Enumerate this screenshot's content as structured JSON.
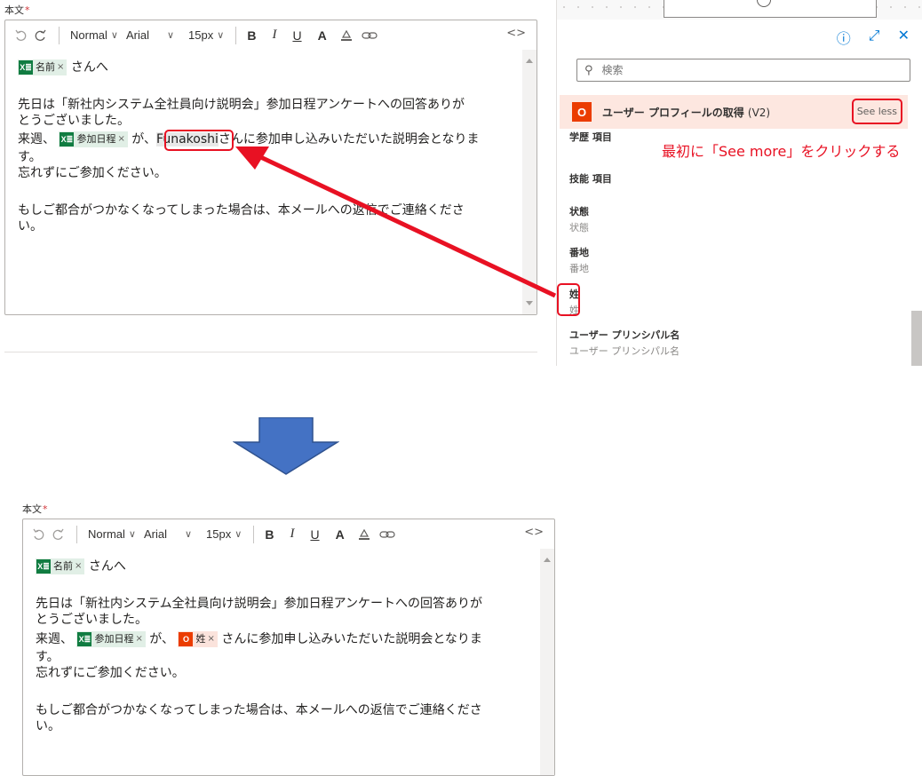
{
  "editor": {
    "field_label": "本文",
    "required_mark": "*",
    "toolbar": {
      "paragraph_style": "Normal",
      "font": "Arial",
      "size": "15px",
      "bold": "B",
      "italic": "I",
      "underline": "U",
      "font_color": "A",
      "code_view": "<>"
    },
    "tokens": {
      "name": "名前",
      "date": "参加日程",
      "surname": "姓",
      "remove": "×"
    },
    "text": {
      "greeting_suffix": "さんへ",
      "line1": "先日は「新社内システム全社員向け説明会」参加日程アンケートへの回答ありが",
      "line2": "とうございました。",
      "line3_pre": "来週、",
      "line3_mid": "が、",
      "literal_name": "Funakoshi",
      "line3_post": "さんに参加申し込みいただいた説明会となりま",
      "line3_post_after": "さんに参加申し込みいただいた説明会となりま",
      "line4": "す。",
      "line5": "忘れずにご参加ください。",
      "line6": "もしご都合がつかなくなってしまった場合は、本メールへの返信でご連絡くださ",
      "line7": "い。"
    }
  },
  "panel": {
    "search_placeholder": "検索",
    "action_title": "ユーザー プロフィールの取得",
    "action_version": "(V2)",
    "see_less": "See less",
    "partial_item": "学歴 項目",
    "items": [
      {
        "title": "技能 項目",
        "subtitle": ""
      },
      {
        "title": "状態",
        "subtitle": "状態"
      },
      {
        "title": "番地",
        "subtitle": "番地"
      },
      {
        "title": "姓",
        "subtitle": "姓"
      },
      {
        "title": "ユーザー プリンシパル名",
        "subtitle": "ユーザー プリンシパル名"
      }
    ]
  },
  "annotation": "最初に「See more」をクリックする",
  "colors": {
    "annotation_red": "#e81123",
    "excel_green": "#107c41",
    "office_orange": "#eb3c00",
    "arrow_blue": "#4472c4"
  }
}
